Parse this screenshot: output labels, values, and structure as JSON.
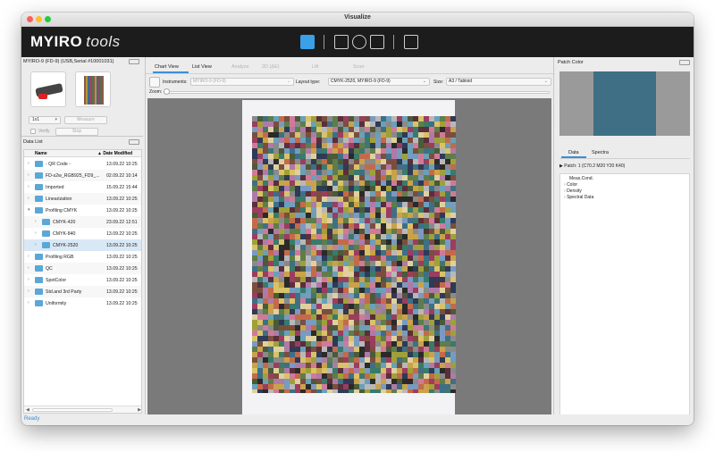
{
  "window": {
    "title": "Visualize"
  },
  "brand": {
    "name": "MYIRO",
    "tools": "tools"
  },
  "toolbar": {
    "icons": [
      "measure-icon",
      "chart-icon",
      "target-icon",
      "curve-icon",
      "export-icon"
    ]
  },
  "device_panel": {
    "title": "MYIRO-9 (FD-9) (USB,Serial #10001031)",
    "mode_value": "1x1",
    "measure_label": "Measure",
    "verify_label": "Verify",
    "stop_label": "Stop"
  },
  "data_list": {
    "title": "Data List",
    "col_name": "Name",
    "col_date": "▲ Date Modified",
    "rows": [
      {
        "name": "- QR Code -",
        "date": "13.09.22 10:25"
      },
      {
        "name": "FD-s2w_RGB925_FD9_...",
        "date": "02.09.22 10:14"
      },
      {
        "name": "Imported",
        "date": "15.09.22 15:44"
      },
      {
        "name": "Linearization",
        "date": "13.09.22 10:25"
      },
      {
        "name": "Profiling CMYK",
        "date": "13.09.22 10:25"
      },
      {
        "name": "CMYK-420",
        "date": "23.09.22 12:51"
      },
      {
        "name": "CMYK-840",
        "date": "13.09.22 10:25"
      },
      {
        "name": "CMYK-2520",
        "date": "13.09.22 10:25"
      },
      {
        "name": "Profiling RGB",
        "date": "13.09.22 10:25"
      },
      {
        "name": "QC",
        "date": "13.09.22 10:25"
      },
      {
        "name": "SpotColor",
        "date": "13.09.22 10:25"
      },
      {
        "name": "Std.and 3rd Party",
        "date": "13.09.22 10:25"
      },
      {
        "name": "Uniformity",
        "date": "13.09.22 10:25"
      }
    ]
  },
  "center": {
    "tabs": [
      "Chart View",
      "List View",
      "Analyze",
      "2D (ΔE)",
      "Lift",
      "Scan"
    ],
    "instruments_label": "Instruments:",
    "instruments_value": "MYIRO-9 (FD-9)",
    "layout_label": "Layout type:",
    "layout_value": "CMYK-2520, MYIRO-9 (FD-9)",
    "size_label": "Size:",
    "size_value": "A3 / Tabloid",
    "zoom_label": "Zoom:"
  },
  "patch_panel": {
    "title": "Patch Color",
    "patch_color": "#3f6f84",
    "tabs": [
      "Data",
      "Spectra"
    ],
    "patch_label": "Patch:",
    "patch_value": "1 (C70.2 M20 Y20 K40)",
    "tree": [
      "Meas.Cond.",
      "Color",
      "Density",
      "Spectral Data"
    ]
  },
  "status": {
    "text": "Ready"
  }
}
